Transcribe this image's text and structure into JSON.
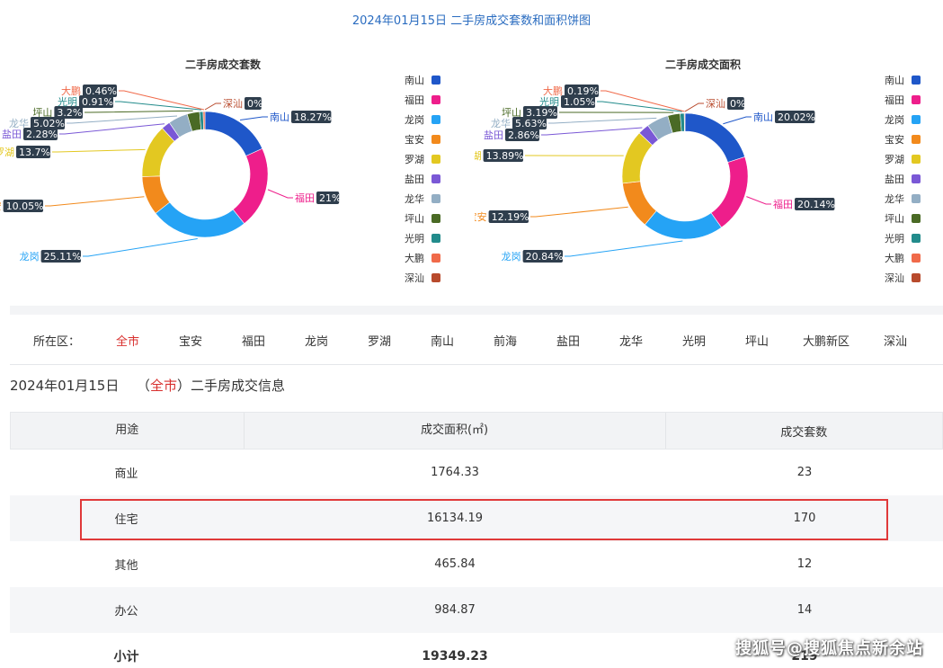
{
  "page_title": "2024年01月15日 二手房成交套数和面积饼图",
  "legend": [
    {
      "name": "南山",
      "color": "#1f57c9"
    },
    {
      "name": "福田",
      "color": "#ee1e8b"
    },
    {
      "name": "龙岗",
      "color": "#25a3f5"
    },
    {
      "name": "宝安",
      "color": "#f28a1c"
    },
    {
      "name": "罗湖",
      "color": "#e3c821"
    },
    {
      "name": "盐田",
      "color": "#7a58d6"
    },
    {
      "name": "龙华",
      "color": "#93aec4"
    },
    {
      "name": "坪山",
      "color": "#4a6a25"
    },
    {
      "name": "光明",
      "color": "#228b8b"
    },
    {
      "name": "大鹏",
      "color": "#f06a4a"
    },
    {
      "name": "深汕",
      "color": "#b84a2c"
    }
  ],
  "chart_data": [
    {
      "type": "pie",
      "title": "二手房成交套数",
      "categories": [
        "南山",
        "福田",
        "龙岗",
        "宝安",
        "罗湖",
        "盐田",
        "龙华",
        "坪山",
        "光明",
        "大鹏",
        "深汕"
      ],
      "values": [
        18.27,
        21,
        25.11,
        10.05,
        13.7,
        2.28,
        5.02,
        3.2,
        0.91,
        0.46,
        0
      ],
      "labels": [
        "18.27%",
        "21%",
        "25.11%",
        "10.05%",
        "13.7%",
        "2.28%",
        "5.02%",
        "3.2%",
        "0.91%",
        "0.46%",
        "0%"
      ],
      "legend_position": "right"
    },
    {
      "type": "pie",
      "title": "二手房成交面积",
      "categories": [
        "南山",
        "福田",
        "龙岗",
        "宝安",
        "罗湖",
        "盐田",
        "龙华",
        "坪山",
        "光明",
        "大鹏",
        "深汕"
      ],
      "values": [
        20.02,
        20.14,
        20.84,
        12.19,
        13.89,
        2.86,
        5.63,
        3.19,
        1.05,
        0.19,
        0
      ],
      "labels": [
        "20.02%",
        "20.14%",
        "20.84%",
        "12.19%",
        "13.89%",
        "2.86%",
        "5.63%",
        "3.19%",
        "1.05%",
        "0.19%",
        "0%"
      ],
      "legend_position": "right"
    }
  ],
  "district_filter": {
    "label": "所在区：",
    "items": [
      "全市",
      "宝安",
      "福田",
      "龙岗",
      "罗湖",
      "南山",
      "前海",
      "盐田",
      "龙华",
      "光明",
      "坪山",
      "大鹏新区",
      "深汕"
    ],
    "active": "全市"
  },
  "info": {
    "date": "2024年01月15日",
    "open_paren": "（",
    "city": "全市",
    "close_paren": "）",
    "suffix": "二手房成交信息"
  },
  "table": {
    "headers": [
      "用途",
      "成交面积(㎡)",
      "成交套数"
    ],
    "rows": [
      [
        "商业",
        "1764.33",
        "23"
      ],
      [
        "住宅",
        "16134.19",
        "170"
      ],
      [
        "其他",
        "465.84",
        "12"
      ],
      [
        "办公",
        "984.87",
        "14"
      ]
    ],
    "total": [
      "小计",
      "19349.23",
      "219"
    ]
  },
  "highlight_color": "#e0393a",
  "watermark": "搜狐号@搜狐焦点新余站"
}
